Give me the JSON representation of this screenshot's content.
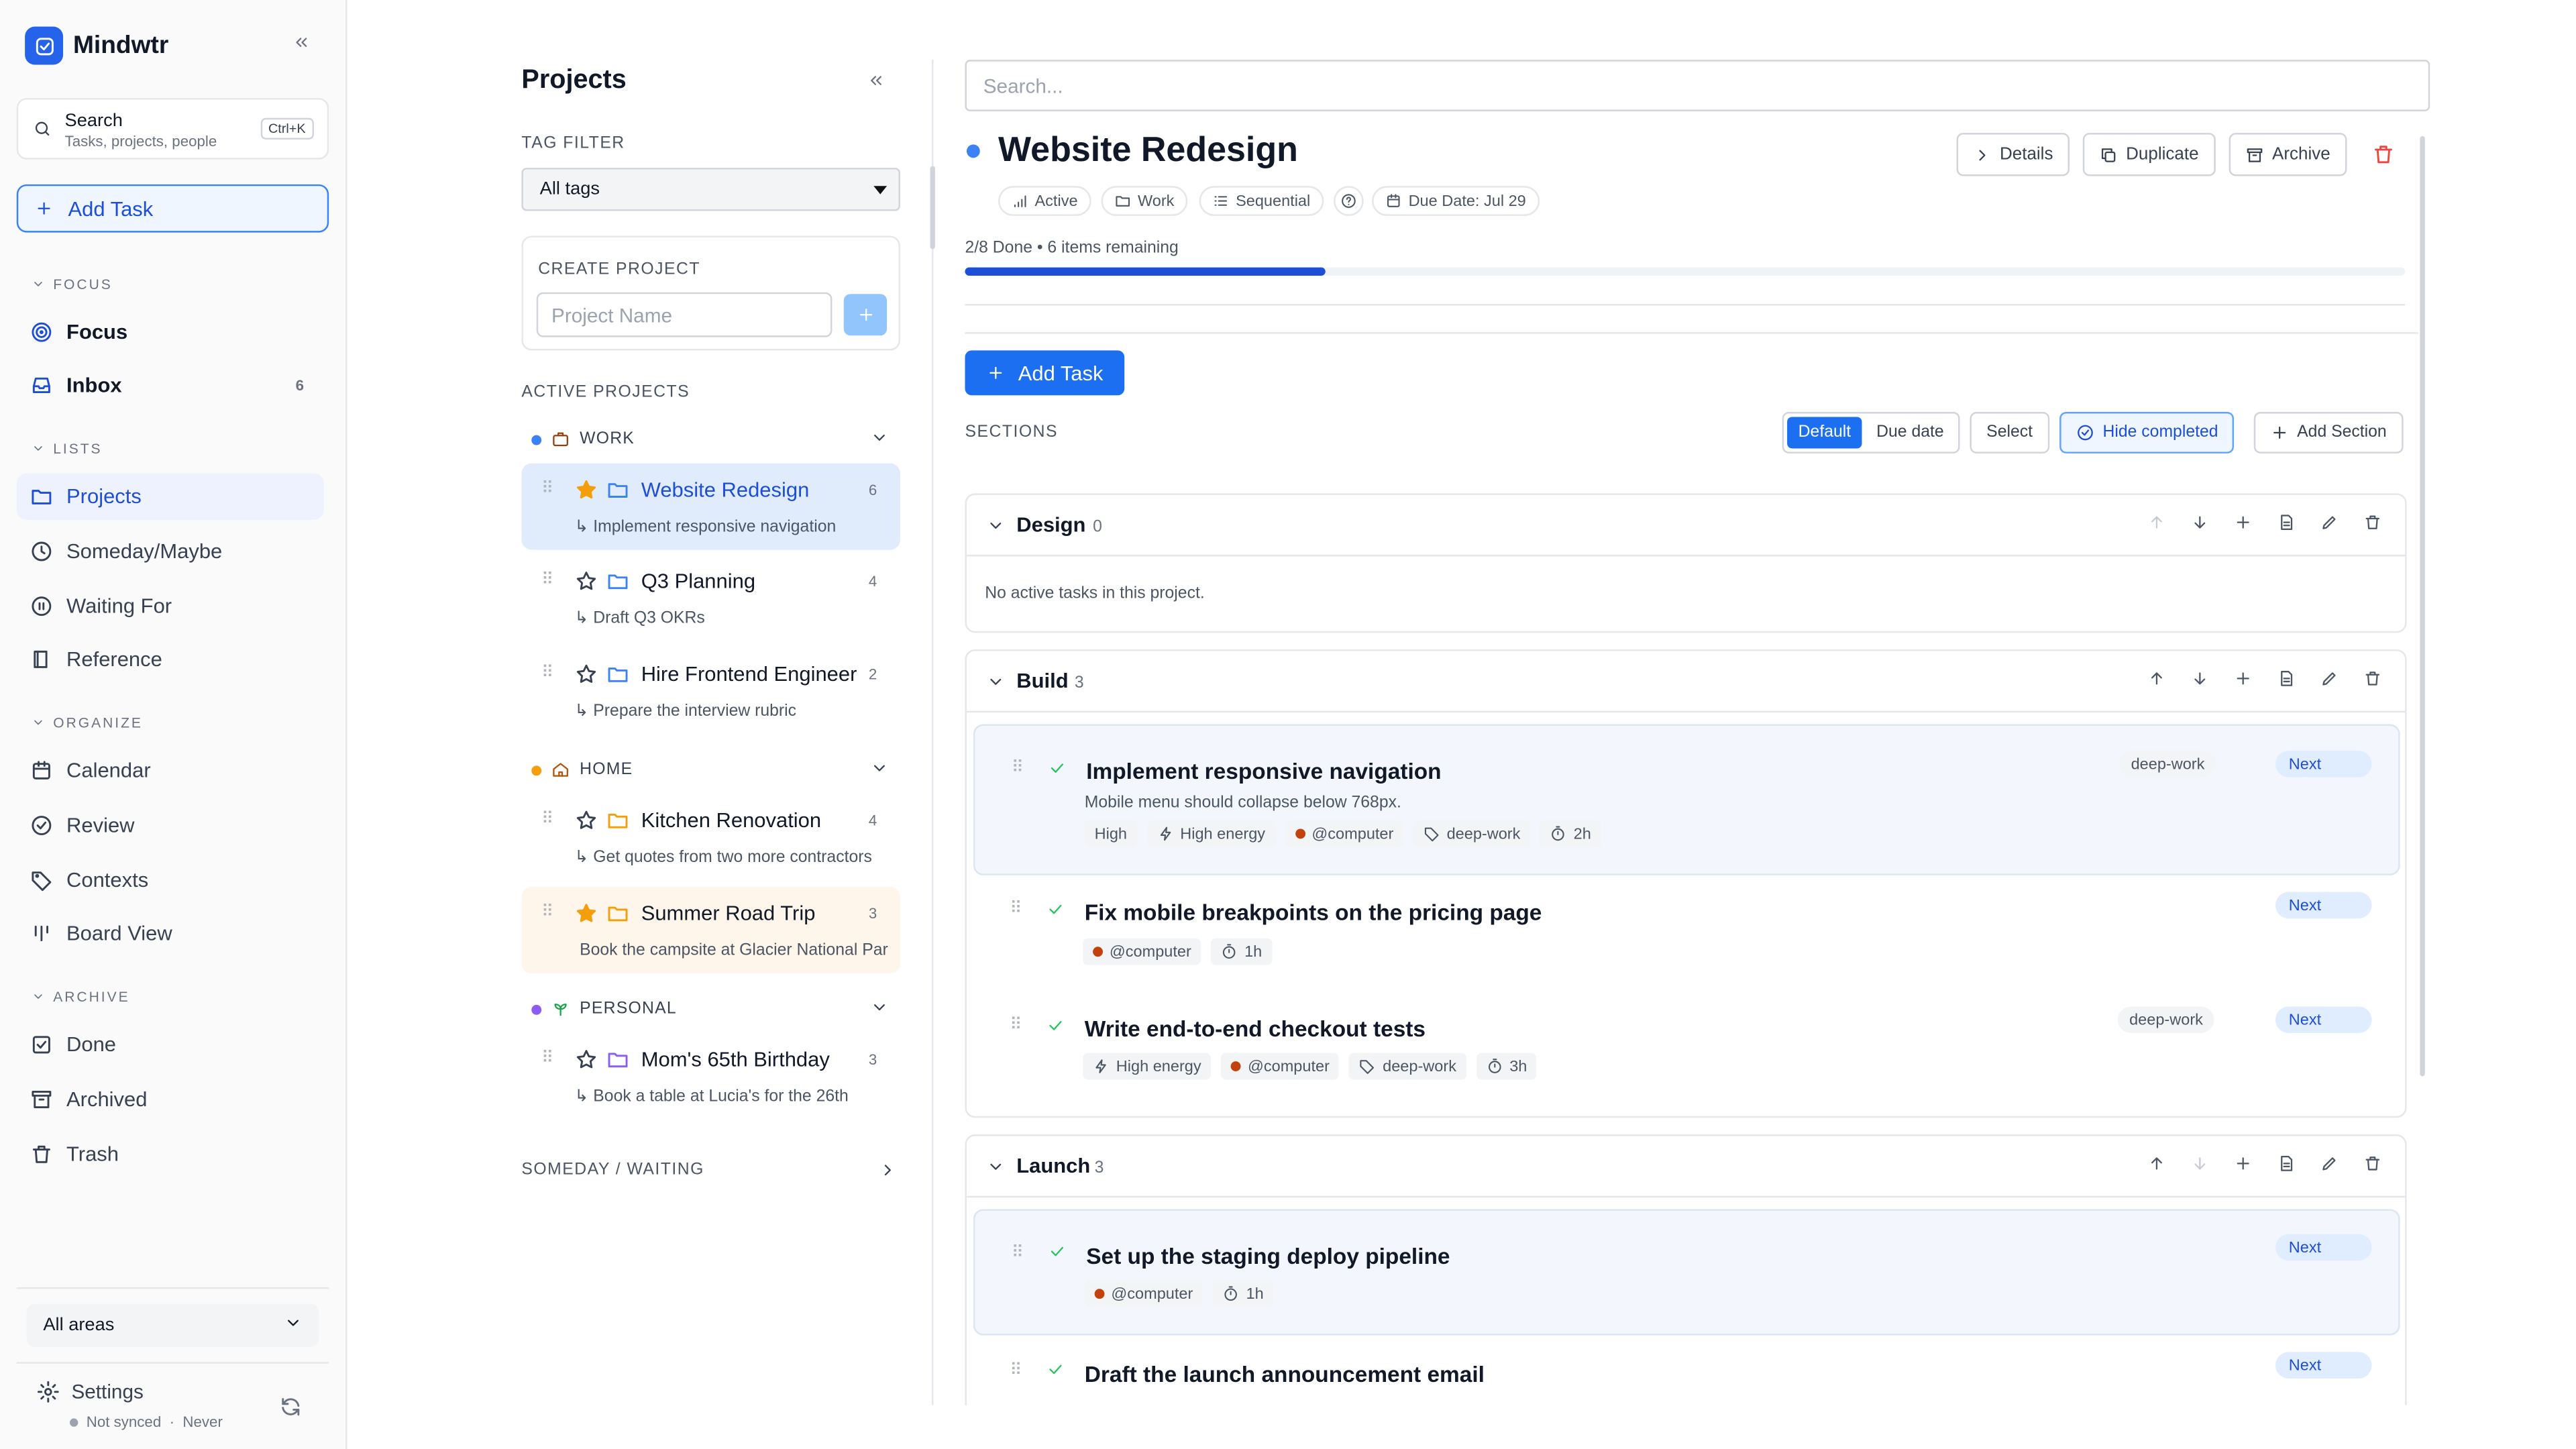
{
  "app": {
    "name": "Mindwtr"
  },
  "sidebar": {
    "search": {
      "title": "Search",
      "subtitle": "Tasks, projects, people",
      "shortcut": "Ctrl+K"
    },
    "add_task": "Add Task",
    "sections": {
      "focus": "FOCUS",
      "lists": "LISTS",
      "organize": "ORGANIZE",
      "archive": "ARCHIVE"
    },
    "focus_items": [
      {
        "label": "Focus"
      },
      {
        "label": "Inbox",
        "badge": "6"
      }
    ],
    "list_items": [
      {
        "label": "Projects"
      },
      {
        "label": "Someday/Maybe"
      },
      {
        "label": "Waiting For"
      },
      {
        "label": "Reference"
      }
    ],
    "organize_items": [
      {
        "label": "Calendar"
      },
      {
        "label": "Review"
      },
      {
        "label": "Contexts"
      },
      {
        "label": "Board View"
      }
    ],
    "archive_items": [
      {
        "label": "Done"
      },
      {
        "label": "Archived"
      },
      {
        "label": "Trash"
      }
    ],
    "area_select": "All areas",
    "settings": "Settings",
    "sync_status": "Not synced",
    "sync_time": "Never"
  },
  "projects_panel": {
    "title": "Projects",
    "tag_filter_label": "TAG FILTER",
    "tag_filter_value": "All tags",
    "create_label": "CREATE PROJECT",
    "project_name_placeholder": "Project Name",
    "active_label": "ACTIVE PROJECTS",
    "groups": [
      {
        "name": "WORK",
        "color": "#3b82f6",
        "icon": "briefcase-icon",
        "projects": [
          {
            "name": "Website Redesign",
            "count": "6",
            "next": "↳ Implement responsive navigation",
            "starred": true
          },
          {
            "name": "Q3 Planning",
            "count": "4",
            "next": "↳ Draft Q3 OKRs",
            "starred": false
          },
          {
            "name": "Hire Frontend Engineer",
            "count": "2",
            "next": "↳ Prepare the interview rubric",
            "starred": false
          }
        ]
      },
      {
        "name": "HOME",
        "color": "#f59e0b",
        "icon": "house-icon",
        "projects": [
          {
            "name": "Kitchen Renovation",
            "count": "4",
            "next": "↳ Get quotes from two more contractors",
            "starred": false
          },
          {
            "name": "Summer Road Trip",
            "count": "3",
            "next": "Book the campsite at Glacier National Park",
            "starred": true
          }
        ]
      },
      {
        "name": "PERSONAL",
        "color": "#8b5cf6",
        "icon": "seedling-icon",
        "projects": [
          {
            "name": "Mom's 65th Birthday",
            "count": "3",
            "next": "↳ Book a table at Lucia's for the 26th",
            "starred": false
          }
        ]
      }
    ],
    "someday_label": "SOMEDAY / WAITING"
  },
  "main": {
    "search_placeholder": "Search...",
    "project_title": "Website Redesign",
    "buttons": {
      "details": "Details",
      "duplicate": "Duplicate",
      "archive": "Archive"
    },
    "chips": {
      "status": "Active",
      "area": "Work",
      "mode": "Sequential",
      "due": "Due Date: Jul 29"
    },
    "progress": {
      "text": "2/8 Done • 6 items remaining",
      "done": 2,
      "total": 8
    },
    "add_task": "Add Task",
    "sections_label": "SECTIONS",
    "sort": {
      "default": "Default",
      "due": "Due date"
    },
    "select": "Select",
    "hide_completed": "Hide completed",
    "add_section": "Add Section",
    "sections": [
      {
        "name": "Design",
        "count": "0",
        "empty": "No active tasks in this project."
      },
      {
        "name": "Build",
        "count": "3",
        "tasks": [
          {
            "title": "Implement responsive navigation",
            "desc": "Mobile menu should collapse below 768px.",
            "tags": [
              "High",
              "High energy",
              "@computer",
              "deep-work",
              "2h"
            ],
            "label": "deep-work",
            "status": "Next"
          },
          {
            "title": "Fix mobile breakpoints on the pricing page",
            "tags": [
              "@computer",
              "1h"
            ],
            "status": "Next"
          },
          {
            "title": "Write end-to-end checkout tests",
            "tags": [
              "High energy",
              "@computer",
              "deep-work",
              "3h"
            ],
            "label": "deep-work",
            "status": "Next"
          }
        ]
      },
      {
        "name": "Launch",
        "count": "3",
        "tasks": [
          {
            "title": "Set up the staging deploy pipeline",
            "tags": [
              "@computer",
              "1h"
            ],
            "status": "Next"
          },
          {
            "title": "Draft the launch announcement email",
            "status": "Next"
          }
        ]
      }
    ]
  }
}
